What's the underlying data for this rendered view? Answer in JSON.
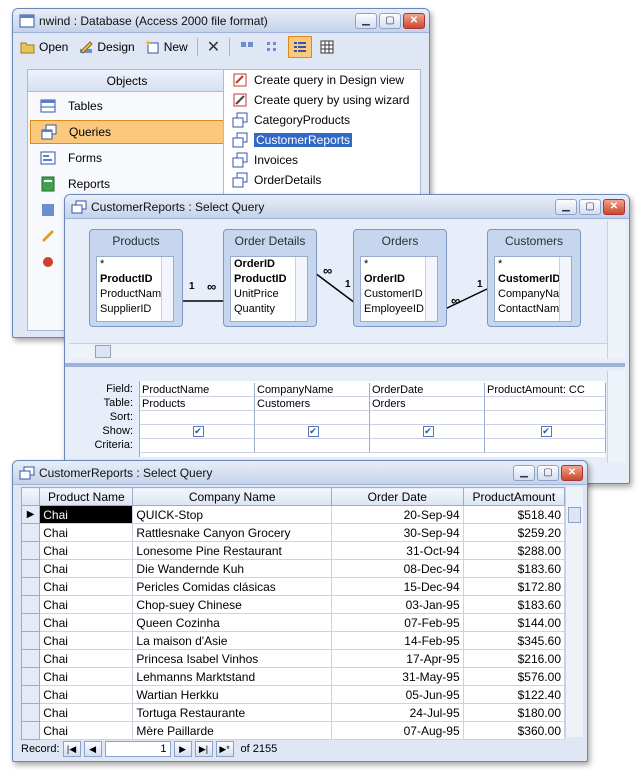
{
  "db_window": {
    "title": "nwind : Database (Access 2000 file format)",
    "toolbar": {
      "open": "Open",
      "design": "Design",
      "new": "New"
    },
    "objects_header": "Objects",
    "objects": [
      "Tables",
      "Queries",
      "Forms",
      "Reports"
    ],
    "selected_object": "Queries",
    "queries": [
      "Create query in Design view",
      "Create query by using wizard",
      "CategoryProducts",
      "CustomerReports",
      "Invoices",
      "OrderDetails"
    ],
    "selected_query": "CustomerReports"
  },
  "design_window": {
    "title": "CustomerReports : Select Query",
    "tables": [
      {
        "name": "Products",
        "fields": [
          "*",
          "ProductID",
          "ProductName",
          "SupplierID"
        ]
      },
      {
        "name": "Order Details",
        "fields": [
          "OrderID",
          "ProductID",
          "UnitPrice",
          "Quantity"
        ]
      },
      {
        "name": "Orders",
        "fields": [
          "*",
          "OrderID",
          "CustomerID",
          "EmployeeID"
        ]
      },
      {
        "name": "Customers",
        "fields": [
          "*",
          "CustomerID",
          "CompanyName",
          "ContactName"
        ]
      }
    ],
    "join_labels": {
      "one": "1",
      "many": "∞"
    },
    "row_labels": [
      "Field:",
      "Table:",
      "Sort:",
      "Show:",
      "Criteria:"
    ],
    "columns": [
      {
        "field": "ProductName",
        "table": "Products"
      },
      {
        "field": "CompanyName",
        "table": "Customers"
      },
      {
        "field": "OrderDate",
        "table": "Orders"
      },
      {
        "field": "ProductAmount: CC",
        "table": ""
      }
    ]
  },
  "datasheet": {
    "title": "CustomerReports : Select Query",
    "headers": [
      "Product Name",
      "Company Name",
      "Order Date",
      "ProductAmount"
    ],
    "rows": [
      [
        "Chai",
        "QUICK-Stop",
        "20-Sep-94",
        "$518.40"
      ],
      [
        "Chai",
        "Rattlesnake Canyon Grocery",
        "30-Sep-94",
        "$259.20"
      ],
      [
        "Chai",
        "Lonesome Pine Restaurant",
        "31-Oct-94",
        "$288.00"
      ],
      [
        "Chai",
        "Die Wandernde Kuh",
        "08-Dec-94",
        "$183.60"
      ],
      [
        "Chai",
        "Pericles Comidas clásicas",
        "15-Dec-94",
        "$172.80"
      ],
      [
        "Chai",
        "Chop-suey Chinese",
        "03-Jan-95",
        "$183.60"
      ],
      [
        "Chai",
        "Queen Cozinha",
        "07-Feb-95",
        "$144.00"
      ],
      [
        "Chai",
        "La maison d'Asie",
        "14-Feb-95",
        "$345.60"
      ],
      [
        "Chai",
        "Princesa Isabel Vinhos",
        "17-Apr-95",
        "$216.00"
      ],
      [
        "Chai",
        "Lehmanns Marktstand",
        "31-May-95",
        "$576.00"
      ],
      [
        "Chai",
        "Wartian Herkku",
        "05-Jun-95",
        "$122.40"
      ],
      [
        "Chai",
        "Tortuga Restaurante",
        "24-Jul-95",
        "$180.00"
      ],
      [
        "Chai",
        "Mère Paillarde",
        "07-Aug-95",
        "$360.00"
      ]
    ],
    "record_label": "Record:",
    "record_current": "1",
    "record_of": "of",
    "record_total": "2155"
  }
}
